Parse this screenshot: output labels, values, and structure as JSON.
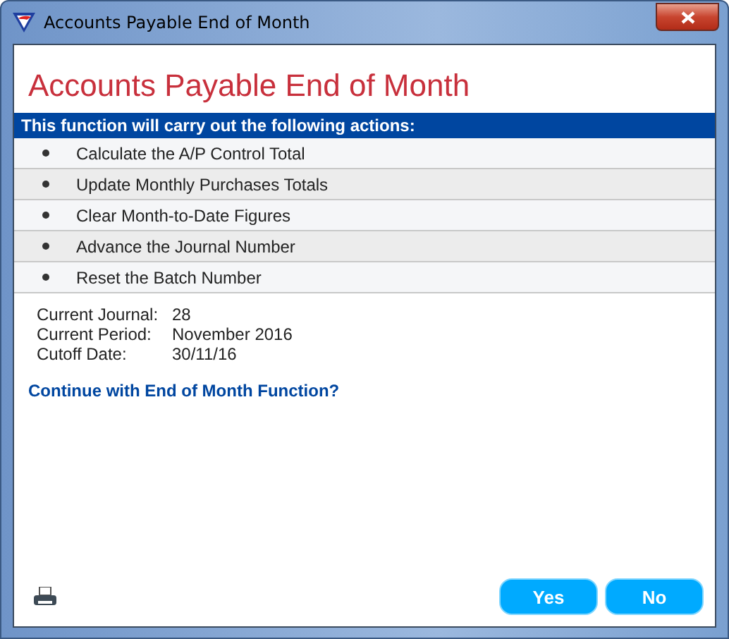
{
  "window": {
    "title": "Accounts Payable End of Month"
  },
  "heading": "Accounts Payable End of Month",
  "actions_header": "This function will carry out the following actions:",
  "actions": [
    "Calculate the A/P Control Total",
    "Update Monthly Purchases Totals",
    "Clear Month-to-Date Figures",
    "Advance the Journal Number",
    "Reset the Batch Number"
  ],
  "details": [
    {
      "label": "Current Journal:",
      "value": "28"
    },
    {
      "label": "Current Period:",
      "value": "November 2016"
    },
    {
      "label": "Cutoff Date:",
      "value": "30/11/16"
    }
  ],
  "question": "Continue with End of Month Function?",
  "buttons": [
    "Yes",
    "No"
  ]
}
